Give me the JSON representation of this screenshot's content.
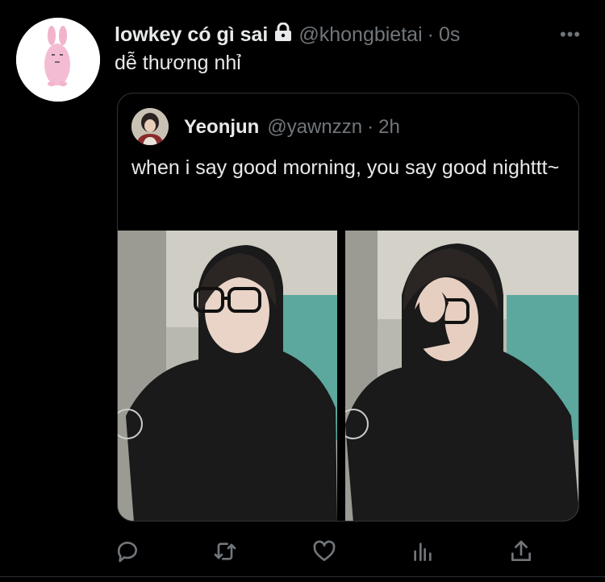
{
  "tweet": {
    "display_name": "lowkey có gì sai",
    "handle": "@khongbietai",
    "separator": "·",
    "time": "0s",
    "more": "•••",
    "text": "dễ thương nhỉ"
  },
  "quoted": {
    "display_name": "Yeonjun",
    "handle": "@yawnzzn",
    "separator": "·",
    "time": "2h",
    "text": "when i say good morning, you say good nighttt~"
  },
  "actions": [
    {
      "icon": "reply-icon"
    },
    {
      "icon": "retweet-icon"
    },
    {
      "icon": "like-icon"
    },
    {
      "icon": "analytics-icon"
    },
    {
      "icon": "share-icon"
    }
  ],
  "colors": {
    "background": "#000000",
    "text": "#e7e9ea",
    "secondary": "#71767b",
    "border": "#2f3336"
  }
}
